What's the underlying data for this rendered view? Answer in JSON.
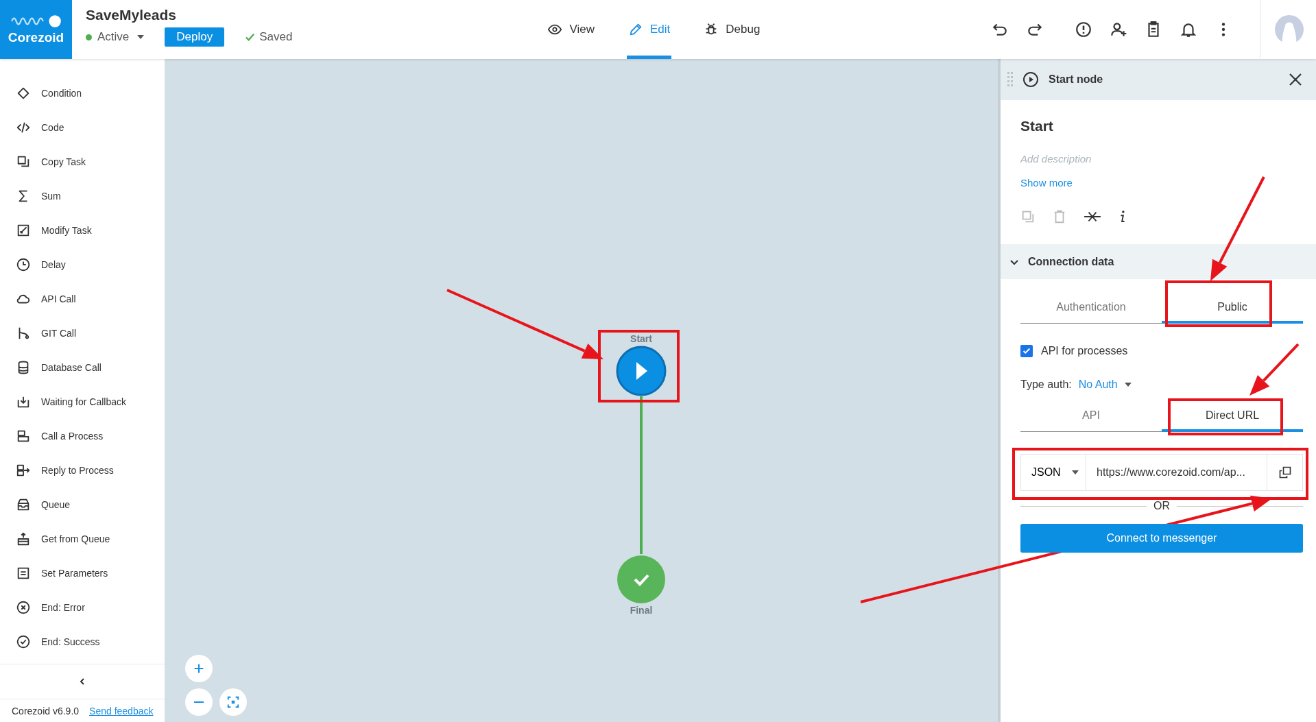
{
  "logo": {
    "text": "Corezoid"
  },
  "process": {
    "title": "SaveMyleads",
    "status": "Active",
    "deploy_button": "Deploy",
    "save_state": "Saved"
  },
  "nav_tabs": [
    {
      "label": "View",
      "selected": false
    },
    {
      "label": "Edit",
      "selected": true
    },
    {
      "label": "Debug",
      "selected": false
    }
  ],
  "sidebar": {
    "items": [
      "Condition",
      "Code",
      "Copy Task",
      "Sum",
      "Modify Task",
      "Delay",
      "API Call",
      "GIT Call",
      "Database Call",
      "Waiting for Callback",
      "Call a Process",
      "Reply to Process",
      "Queue",
      "Get from Queue",
      "Set Parameters",
      "End: Error",
      "End: Success"
    ],
    "version": "Corezoid v6.9.0",
    "feedback_link": "Send feedback"
  },
  "canvas": {
    "nodes": [
      {
        "label": "Start",
        "kind": "start"
      },
      {
        "label": "Final",
        "kind": "final"
      }
    ]
  },
  "panel": {
    "header": "Start node",
    "title": "Start",
    "description": {
      "placeholder": "Add description"
    },
    "show_more": "Show more",
    "section": {
      "title": "Connection data",
      "expanded": true
    },
    "tabs": [
      {
        "label": "Authentication",
        "selected": false
      },
      {
        "label": "Public",
        "selected": true
      }
    ],
    "api_checkbox": {
      "label": "API for processes",
      "checked": true
    },
    "type_auth": {
      "label": "Type auth:",
      "value": "No Auth"
    },
    "url_tabs": [
      {
        "label": "API",
        "selected": false
      },
      {
        "label": "Direct URL",
        "selected": true
      }
    ],
    "format": "JSON",
    "url": "https://www.corezoid.com/ap...",
    "separator": "OR",
    "connect_button": "Connect to messenger"
  }
}
